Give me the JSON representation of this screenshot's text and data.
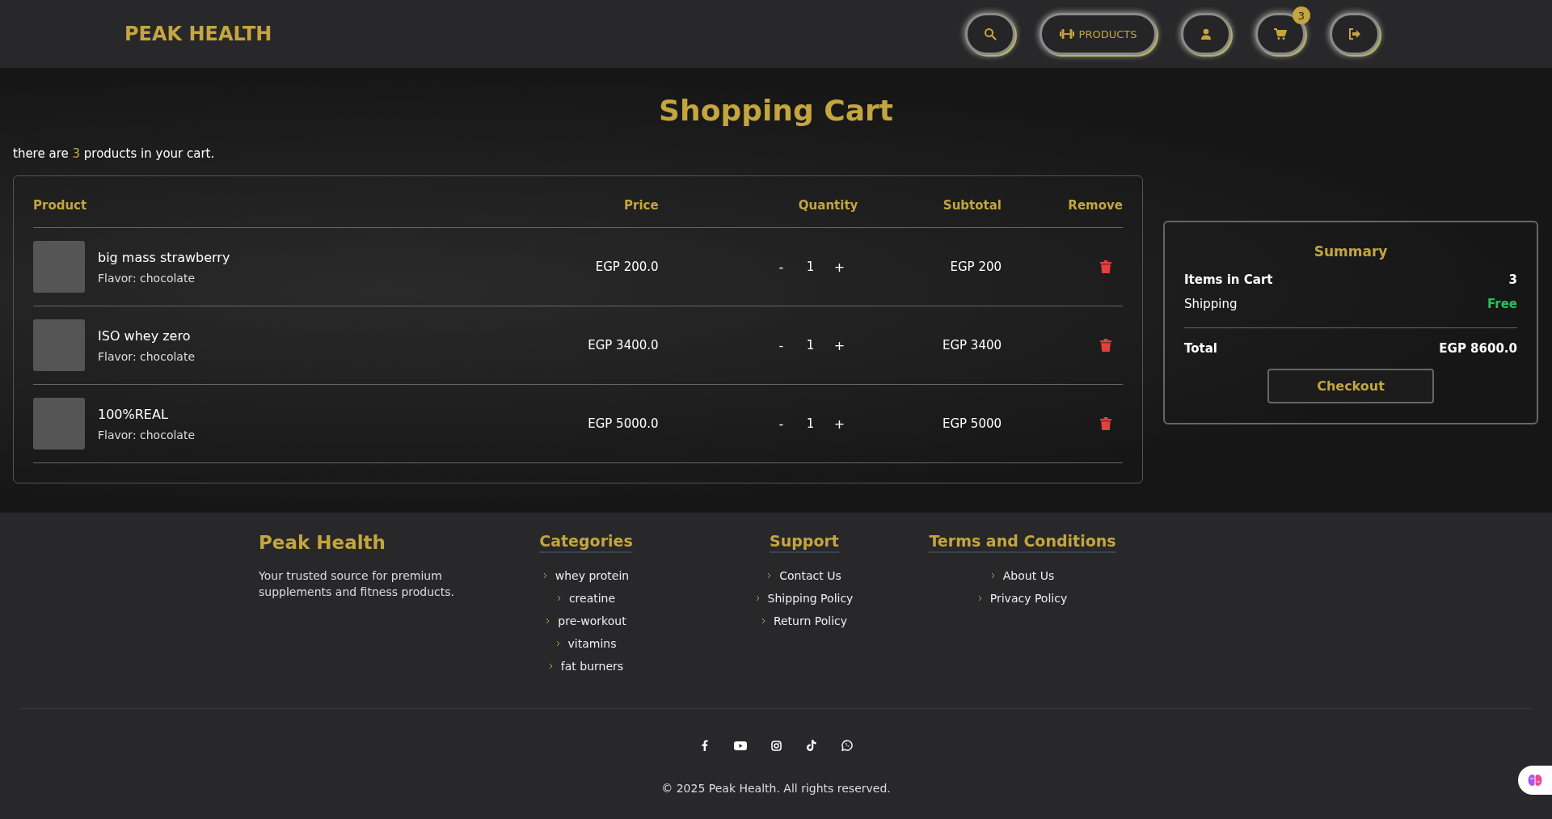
{
  "header": {
    "logo": "PEAK HEALTH",
    "nav": [
      {
        "kind": "search"
      },
      {
        "kind": "products",
        "label": "PRODUCTS"
      },
      {
        "kind": "user"
      },
      {
        "kind": "cart",
        "badge": "3"
      },
      {
        "kind": "logout"
      }
    ]
  },
  "page_title": "Shopping Cart",
  "cart_note": {
    "prefix": "there are",
    "count": "3",
    "suffix": "products in your cart."
  },
  "table": {
    "columns": [
      "Product",
      "Price",
      "Quantity",
      "Subtotal",
      "Remove"
    ],
    "rows": [
      {
        "name": "big mass strawberry",
        "flavor": "Flavor: chocolate",
        "price": "EGP 200.0",
        "minus": "-",
        "quantity": "1",
        "plus": "+",
        "subtotal": "EGP 200"
      },
      {
        "name": "ISO whey zero",
        "flavor": "Flavor: chocolate",
        "price": "EGP 3400.0",
        "minus": "-",
        "quantity": "1",
        "plus": "+",
        "subtotal": "EGP 3400"
      },
      {
        "name": "100%REAL",
        "flavor": "Flavor: chocolate",
        "price": "EGP 5000.0",
        "minus": "-",
        "quantity": "1",
        "plus": "+",
        "subtotal": "EGP 5000"
      }
    ]
  },
  "summary": {
    "title": "Summary",
    "items_label": "Items in Cart",
    "items_value": "3",
    "shipping_label": "Shipping",
    "shipping_value": "Free",
    "total_label": "Total",
    "total_value": "EGP 8600.0",
    "checkout": "Checkout"
  },
  "footer": {
    "brand": "Peak Health",
    "tagline": "Your trusted source for premium supplements and fitness products.",
    "columns": [
      {
        "title": "Categories",
        "links": [
          "whey protein",
          "creatine",
          "pre-workout",
          "vitamins",
          "fat burners"
        ]
      },
      {
        "title": "Support",
        "links": [
          "Contact Us",
          "Shipping Policy",
          "Return Policy"
        ]
      },
      {
        "title": "Terms and Conditions",
        "links": [
          "About Us",
          "Privacy Policy"
        ]
      }
    ],
    "social": [
      {
        "kind": "facebook"
      },
      {
        "kind": "youtube"
      },
      {
        "kind": "instagram"
      },
      {
        "kind": "tiktok"
      },
      {
        "kind": "whatsapp"
      }
    ],
    "copyright": "© 2025 Peak Health. All rights reserved."
  }
}
